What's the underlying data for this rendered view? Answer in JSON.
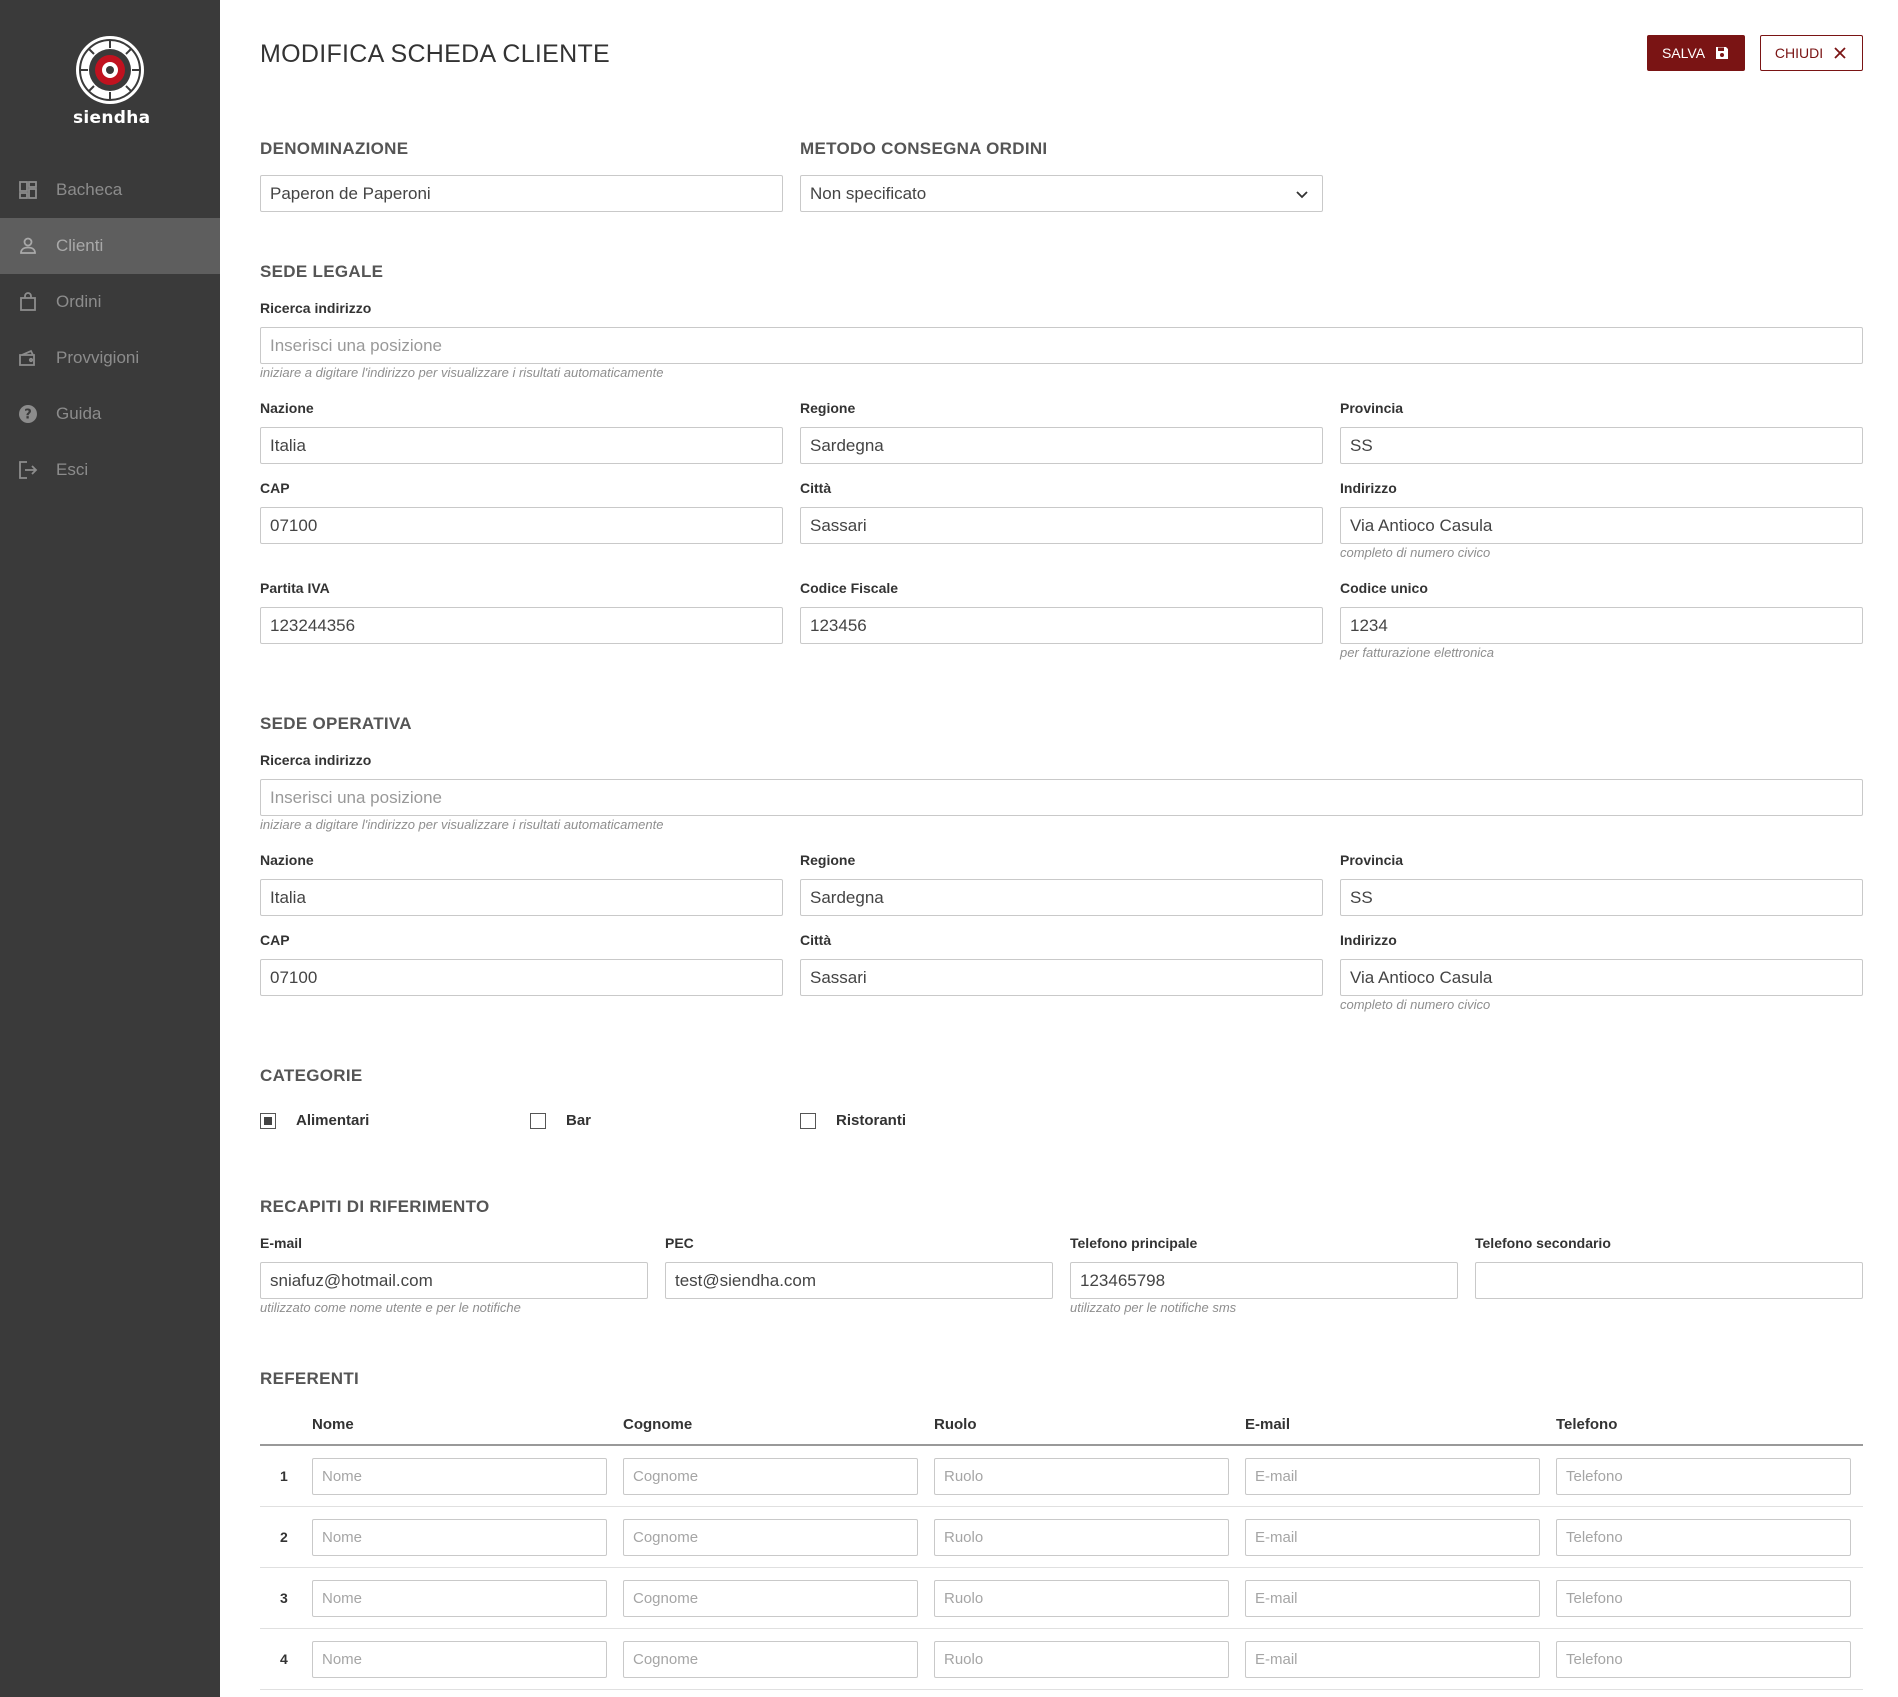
{
  "sidebar": {
    "logo_text": "siendha",
    "items": [
      {
        "label": "Bacheca",
        "icon": "dashboard-icon",
        "active": false
      },
      {
        "label": "Clienti",
        "icon": "user-icon",
        "active": true
      },
      {
        "label": "Ordini",
        "icon": "bag-icon",
        "active": false
      },
      {
        "label": "Provvigioni",
        "icon": "wallet-icon",
        "active": false
      },
      {
        "label": "Guida",
        "icon": "help-icon",
        "active": false
      },
      {
        "label": "Esci",
        "icon": "logout-icon",
        "active": false
      }
    ]
  },
  "header": {
    "title": "MODIFICA SCHEDA CLIENTE",
    "save_label": "SALVA",
    "close_label": "CHIUDI"
  },
  "top": {
    "denominazione_title": "DENOMINAZIONE",
    "denominazione_value": "Paperon de Paperoni",
    "metodo_title": "METODO CONSEGNA ORDINI",
    "metodo_value": "Non specificato"
  },
  "sede_legale": {
    "title": "SEDE LEGALE",
    "ricerca_label": "Ricerca indirizzo",
    "ricerca_placeholder": "Inserisci una posizione",
    "ricerca_help": "iniziare a digitare l'indirizzo per visualizzare i risultati automaticamente",
    "nazione_label": "Nazione",
    "nazione": "Italia",
    "regione_label": "Regione",
    "regione": "Sardegna",
    "provincia_label": "Provincia",
    "provincia": "SS",
    "cap_label": "CAP",
    "cap": "07100",
    "citta_label": "Città",
    "citta": "Sassari",
    "indirizzo_label": "Indirizzo",
    "indirizzo": "Via Antioco Casula",
    "indirizzo_help": "completo di numero civico",
    "piva_label": "Partita IVA",
    "piva": "123244356",
    "cf_label": "Codice Fiscale",
    "cf": "123456",
    "cu_label": "Codice unico",
    "cu": "1234",
    "cu_help": "per fatturazione elettronica"
  },
  "sede_operativa": {
    "title": "SEDE OPERATIVA",
    "ricerca_label": "Ricerca indirizzo",
    "ricerca_placeholder": "Inserisci una posizione",
    "ricerca_help": "iniziare a digitare l'indirizzo per visualizzare i risultati automaticamente",
    "nazione_label": "Nazione",
    "nazione": "Italia",
    "regione_label": "Regione",
    "regione": "Sardegna",
    "provincia_label": "Provincia",
    "provincia": "SS",
    "cap_label": "CAP",
    "cap": "07100",
    "citta_label": "Città",
    "citta": "Sassari",
    "indirizzo_label": "Indirizzo",
    "indirizzo": "Via Antioco Casula",
    "indirizzo_help": "completo di numero civico"
  },
  "categorie": {
    "title": "CATEGORIE",
    "items": [
      {
        "label": "Alimentari",
        "checked": true
      },
      {
        "label": "Bar",
        "checked": false
      },
      {
        "label": "Ristoranti",
        "checked": false
      }
    ]
  },
  "recapiti": {
    "title": "RECAPITI DI RIFERIMENTO",
    "email_label": "E-mail",
    "email": "sniafuz@hotmail.com",
    "email_help": "utilizzato come nome utente e per le notifiche",
    "pec_label": "PEC",
    "pec": "test@siendha.com",
    "tel1_label": "Telefono principale",
    "tel1": "123465798",
    "tel1_help": "utilizzato per le notifiche sms",
    "tel2_label": "Telefono secondario",
    "tel2": ""
  },
  "referenti": {
    "title": "REFERENTI",
    "columns": [
      "Nome",
      "Cognome",
      "Ruolo",
      "E-mail",
      "Telefono"
    ],
    "rows": [
      "1",
      "2",
      "3",
      "4"
    ]
  },
  "colors": {
    "sidebar": "#3a3a3a",
    "active_item": "#5e5e5e",
    "brand": "#7a1414"
  }
}
